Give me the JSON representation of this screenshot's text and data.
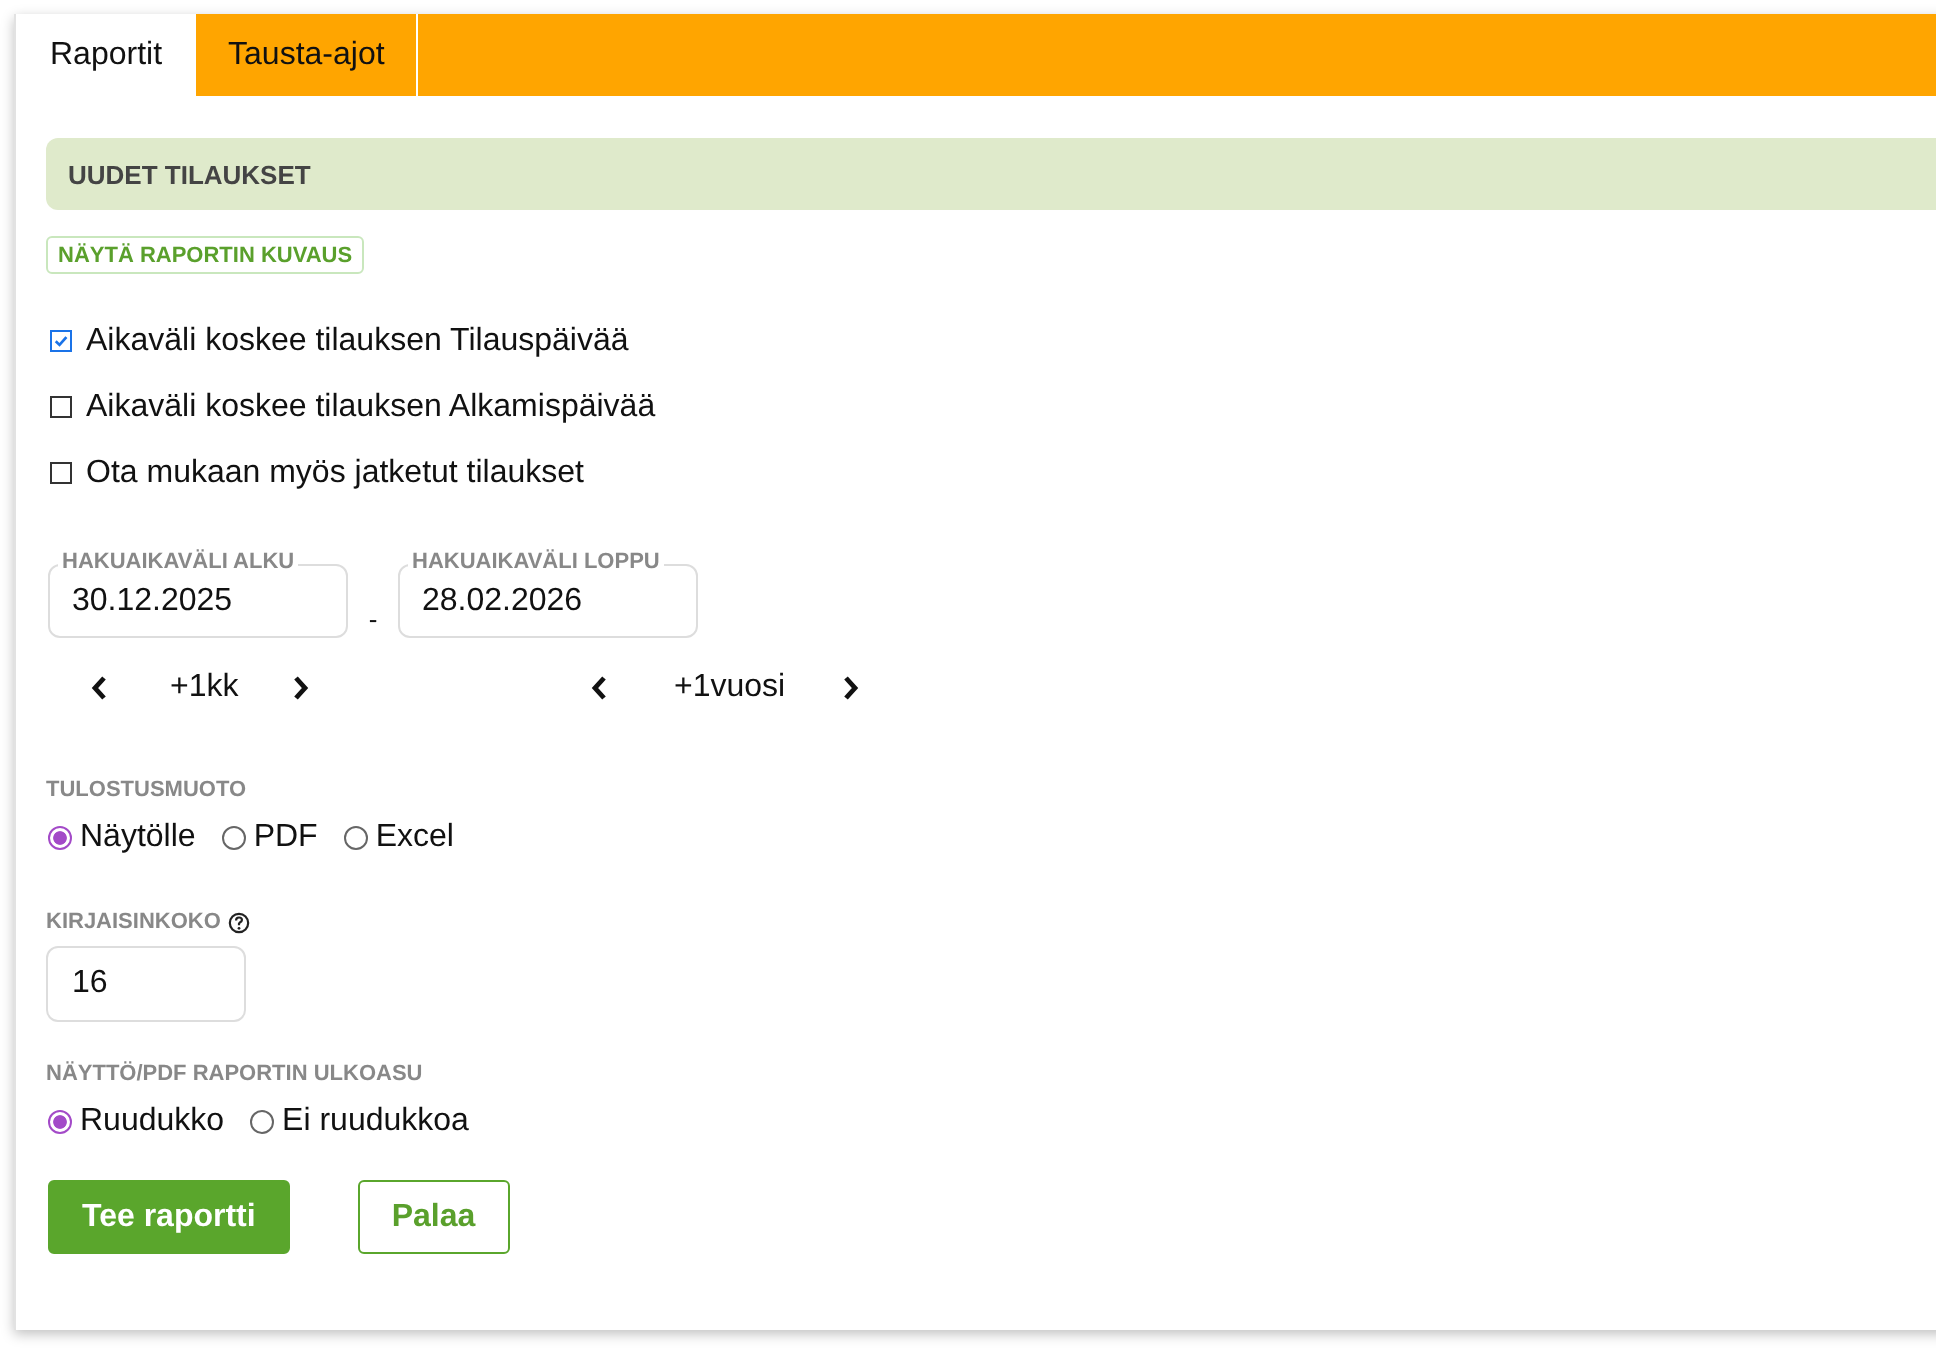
{
  "tabs": [
    {
      "label": "Raportit",
      "selected": true
    },
    {
      "label": "Tausta-ajot",
      "selected": false
    }
  ],
  "report": {
    "title": "UUDET TILAUKSET",
    "description_button": "NÄYTÄ RAPORTIN KUVAUS"
  },
  "options": [
    {
      "label": "Aikaväli koskee tilauksen Tilauspäivää",
      "checked": true
    },
    {
      "label": "Aikaväli koskee tilauksen Alkamispäivää",
      "checked": false
    },
    {
      "label": "Ota mukaan myös jatketut tilaukset",
      "checked": false
    }
  ],
  "date_range": {
    "start": {
      "label": "HAKUAIKAVÄLI ALKU",
      "value": "30.12.2025"
    },
    "separator": "-",
    "end": {
      "label": "HAKUAIKAVÄLI LOPPU",
      "value": "28.02.2026"
    }
  },
  "steppers": [
    {
      "label": "+1kk"
    },
    {
      "label": "+1vuosi"
    }
  ],
  "output_format": {
    "label": "TULOSTUSMUOTO",
    "options": [
      {
        "label": "Näytölle",
        "selected": true
      },
      {
        "label": "PDF",
        "selected": false
      },
      {
        "label": "Excel",
        "selected": false
      }
    ]
  },
  "font_size": {
    "label": "KIRJAISINKOKO",
    "value": "16"
  },
  "layout": {
    "label": "NÄYTTÖ/PDF RAPORTIN ULKOASU",
    "options": [
      {
        "label": "Ruudukko",
        "selected": true
      },
      {
        "label": "Ei ruudukkoa",
        "selected": false
      }
    ]
  },
  "buttons": [
    {
      "label": "Tee raportti",
      "kind": "primary"
    },
    {
      "label": "Palaa",
      "kind": "secondary"
    }
  ]
}
